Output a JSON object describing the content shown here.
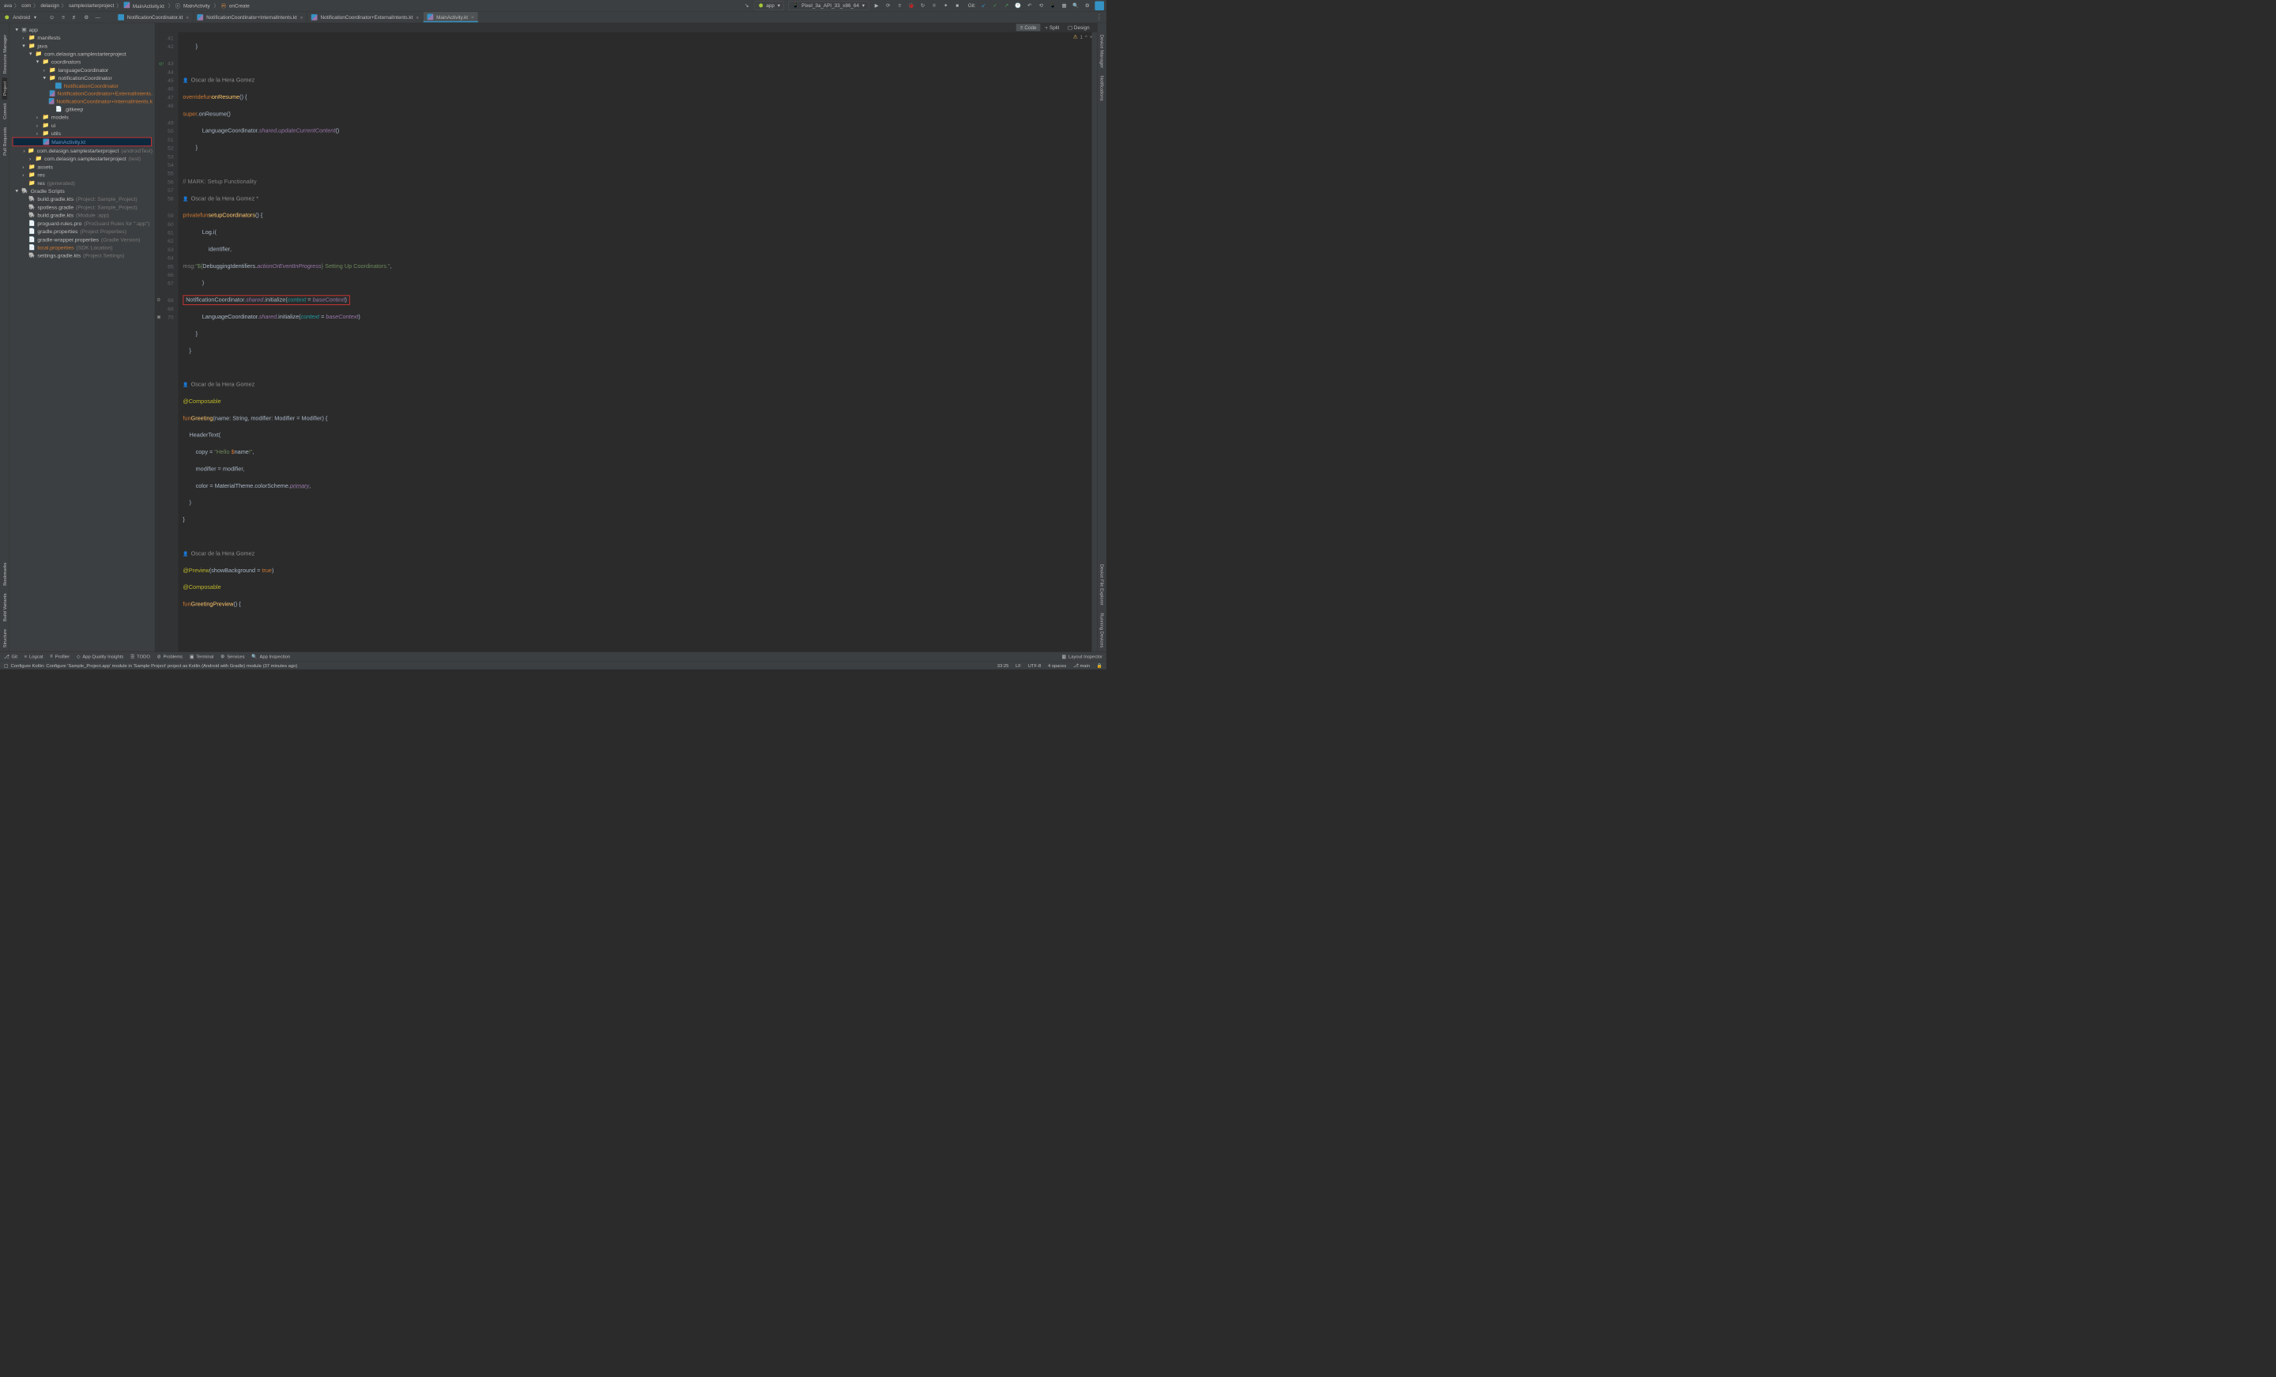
{
  "breadcrumbs": {
    "p1": "ava",
    "p2": "com",
    "p3": "delasign",
    "p4": "samplestarterproject",
    "p5": "MainActivity.kt",
    "p6": "MainActivity",
    "p7": "onCreate"
  },
  "toolbar": {
    "run_config": "app",
    "device": "Pixel_3a_API_33_x86_64",
    "git_label": "Git:"
  },
  "project_dropdown": {
    "label": "Android"
  },
  "editor_tabs": [
    {
      "name": "NotificationCoordinator.kt"
    },
    {
      "name": "NotificationCoordinator+InternalIntents.kt"
    },
    {
      "name": "NotificationCoordinator+ExternalIntents.kt"
    },
    {
      "name": "MainActivity.kt"
    }
  ],
  "view_modes": {
    "code": "Code",
    "split": "Split",
    "design": "Design"
  },
  "warnings": {
    "count": "1"
  },
  "tree": {
    "app": "app",
    "manifests": "manifests",
    "java": "java",
    "pkg": "com.delasign.samplestarterproject",
    "coordinators": "coordinators",
    "languageCoordinator": "languageCoordinator",
    "notificationCoordinator": "notificationCoordinator",
    "nc_main": "NotificationCoordinator",
    "nc_ext": "NotificationCoordinator+ExternalIntents.",
    "nc_int": "NotificationCoordinator+InternalIntents.k",
    "gitkeep": ".gitkeep",
    "models": "models",
    "ui": "ui",
    "utils": "utils",
    "mainactivity": "MainActivity.kt",
    "pkg_androidtest": "com.delasign.samplestarterproject",
    "pkg_androidtest_suffix": "(androidTest)",
    "pkg_test": "com.delasign.samplestarterproject",
    "pkg_test_suffix": "(test)",
    "assets": "assets",
    "res": "res",
    "res_gen": "res",
    "res_gen_suffix": "(generated)",
    "gradle_scripts": "Gradle Scripts",
    "build_gradle_proj": "build.gradle.kts",
    "build_gradle_proj_suffix": "(Project: Sample_Project)",
    "spotless": "spotless.gradle",
    "spotless_suffix": "(Project: Sample_Project)",
    "build_gradle_app": "build.gradle.kts",
    "build_gradle_app_suffix": "(Module :app)",
    "proguard": "proguard-rules.pro",
    "proguard_suffix": "(ProGuard Rules for \":app\")",
    "gradle_props": "gradle.properties",
    "gradle_props_suffix": "(Project Properties)",
    "wrapper_props": "gradle-wrapper.properties",
    "wrapper_props_suffix": "(Gradle Version)",
    "local_props": "local.properties",
    "local_props_suffix": "(SDK Location)",
    "settings": "settings.gradle.kts",
    "settings_suffix": "(Project Settings)"
  },
  "code": {
    "line41": "        }",
    "author1": "Oscar de la Hera Gomez",
    "l43_kw1": "override",
    "l43_kw2": "fun",
    "l43_fn": "onResume",
    "l43_rest": "() {",
    "l44_kw": "super",
    "l44_rest": ".onResume()",
    "l45_a": "            LanguageCoordinator.",
    "l45_b": "shared",
    "l45_c": ".",
    "l45_d": "updateCurrentContent",
    "l45_e": "()",
    "l46": "        }",
    "l48_comment": "// MARK: Setup Functionality",
    "author2": "Oscar de la Hera Gomez *",
    "l49_kw1": "private",
    "l49_kw2": "fun",
    "l49_fn": "setupCoordinators",
    "l49_rest": "() {",
    "l50_a": "            Log.i(",
    "l51_a": "                identifier,",
    "l52_hint": "msg:",
    "l52_str1": "\"${",
    "l52_b": "DebuggingIdentifiers.",
    "l52_c": "actionOrEventInProgress",
    "l52_str2": "}",
    "l52_str3": " Setting Up Coordinators.\"",
    "l52_d": ",",
    "l53_a": "            )",
    "l54_a": "NotificationCoordinator.",
    "l54_b": "shared",
    "l54_c": ".initialize(",
    "l54_param": "context",
    "l54_d": " = ",
    "l54_e": "baseContext",
    "l54_f": ")",
    "l55_a": "            LanguageCoordinator.",
    "l55_b": "shared",
    "l55_c": ".initialize(",
    "l55_param": "context",
    "l55_d": " = ",
    "l55_e": "baseContext",
    "l55_f": ")",
    "l56": "        }",
    "l57": "    }",
    "author3": "Oscar de la Hera Gomez",
    "l59_ann": "@Composable",
    "l60_kw": "fun",
    "l60_fn": "Greeting",
    "l60_a": "(name: String, modifier: Modifier = Modifier) {",
    "l61_a": "    HeaderText(",
    "l62_a": "        copy = ",
    "l62_str": "\"Hello ",
    "l62_b": "$",
    "l62_c": "name",
    "l62_str2": "!\"",
    "l62_d": ",",
    "l63_a": "        modifier = modifier,",
    "l64_a": "        color = MaterialTheme.colorScheme.",
    "l64_b": "primary",
    "l64_c": ",",
    "l65_a": "    )",
    "l66_a": "}",
    "author4": "Oscar de la Hera Gomez",
    "l68_ann": "@Preview",
    "l68_a": "(showBackground = ",
    "l68_kw": "true",
    "l68_b": ")",
    "l69_ann": "@Composable",
    "l70_kw": "fun",
    "l70_fn": "GreetingPreview",
    "l70_a": "() {"
  },
  "left_strips": {
    "resource_manager": "Resource Manager",
    "project": "Project",
    "commit": "Commit",
    "pull_requests": "Pull Requests",
    "bookmarks": "Bookmarks",
    "build_variants": "Build Variants",
    "structure": "Structure"
  },
  "right_strips": {
    "device_manager": "Device Manager",
    "notifications": "Notifications",
    "device_file_explorer": "Device File Explorer",
    "running_devices": "Running Devices"
  },
  "bottom_bar": {
    "git": "Git",
    "logcat": "Logcat",
    "profiler": "Profiler",
    "app_quality": "App Quality Insights",
    "todo": "TODO",
    "problems": "Problems",
    "terminal": "Terminal",
    "services": "Services",
    "app_inspection": "App Inspection",
    "layout_inspector": "Layout Inspector"
  },
  "status_bar": {
    "message": "Configure Kotlin: Configure 'Sample_Project.app' module in 'Sample Project' project as Kotlin (Android with Gradle) module (37 minutes ago)",
    "pos": "33:25",
    "line_sep": "LF",
    "encoding": "UTF-8",
    "indent": "4 spaces",
    "branch": "main"
  }
}
